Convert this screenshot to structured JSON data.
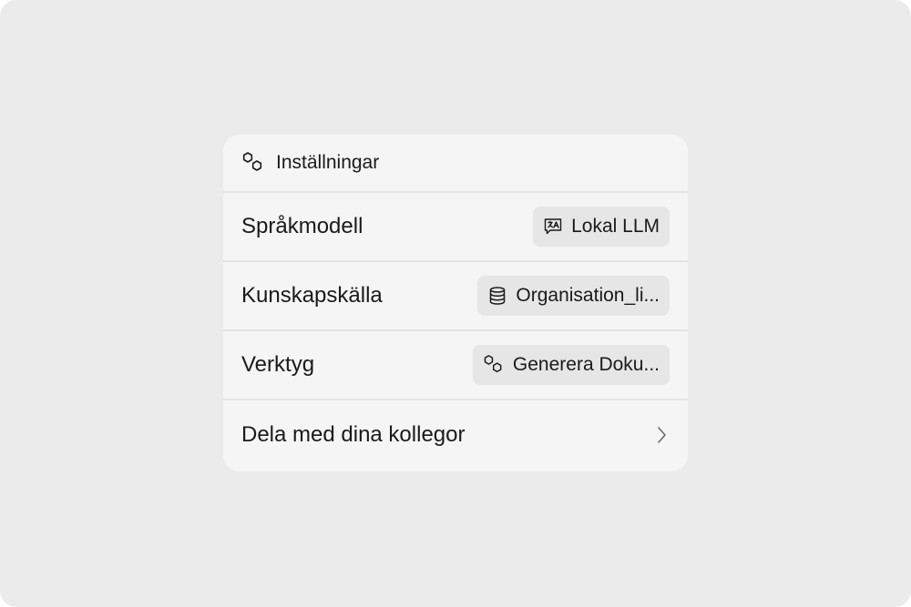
{
  "header": {
    "title": "Inställningar",
    "icon": "hexagons-icon"
  },
  "rows": [
    {
      "label": "Språkmodell",
      "value": "Lokal LLM",
      "icon": "translate-chat-icon"
    },
    {
      "label": "Kunskapskälla",
      "value": "Organisation_li...",
      "icon": "database-icon"
    },
    {
      "label": "Verktyg",
      "value": "Generera Doku...",
      "icon": "hexagons-icon"
    },
    {
      "label": "Dela med dina kollegor",
      "icon": "chevron-right-icon"
    }
  ]
}
